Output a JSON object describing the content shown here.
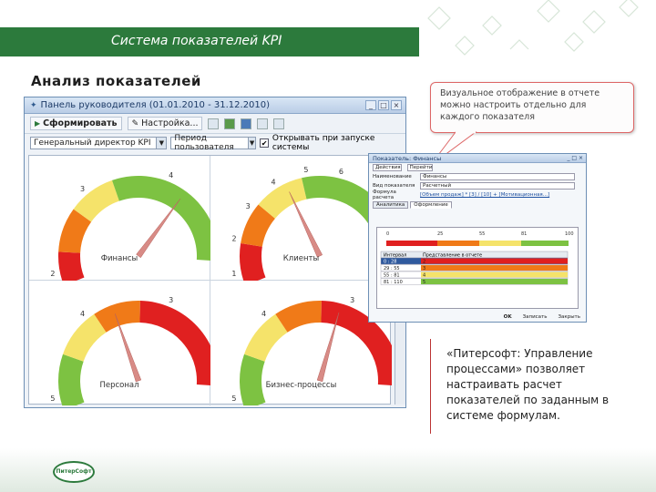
{
  "header": {
    "title": "Система показателей KPI"
  },
  "section_title": "Анализ показателей",
  "main_window": {
    "title": "Панель руководителя  (01.01.2010 - 31.12.2010)",
    "toolbar": {
      "generate_label": "Сформировать",
      "settings_label": "Настройка..."
    },
    "filters": {
      "indicator_value": "Генеральный директор KPI",
      "period_value": "Период пользователя",
      "open_on_start_label": "Открывать при запуске системы",
      "open_on_start_checked": true
    },
    "gauges": [
      {
        "label": "Финансы",
        "scale": [
          "2",
          "3",
          "4",
          "5"
        ],
        "level": 0.72
      },
      {
        "label": "Клиенты",
        "scale": [
          "1",
          "2",
          "3",
          "4",
          "5",
          "6",
          "7",
          "8",
          "9"
        ],
        "level": 0.42
      },
      {
        "label": "Персонал",
        "scale": [
          "5",
          "4",
          "3",
          "2"
        ],
        "level": 0.45
      },
      {
        "label": "Бизнес-процессы",
        "scale": [
          "5",
          "4",
          "3",
          "2"
        ],
        "level": 0.62
      }
    ]
  },
  "callout": {
    "text": "Визуальное отображение в отчете можно настроить отдельно для каждого показателя"
  },
  "small_window": {
    "title": "Показатель: Финансы",
    "menu": [
      "Действия",
      "Перейти"
    ],
    "fields": [
      {
        "label": "Наименование",
        "value": "Финансы"
      },
      {
        "label": "Вид показателя",
        "value": "Расчетный"
      },
      {
        "label": "Формула расчета",
        "value": "[Объем продаж] * [3] / [10] + [Мотивационная...]"
      }
    ],
    "tabs": [
      "Аналитика",
      "Оформление"
    ],
    "scale_ticks": [
      "0",
      "25",
      "55",
      "81",
      "100"
    ],
    "table_headers": [
      "Интервал",
      "Представление в отчете"
    ],
    "table_rows": [
      {
        "interval": "0 : 28",
        "repr": "2",
        "color": "#e02020"
      },
      {
        "interval": "29 : 55",
        "repr": "3",
        "color": "#f07a18"
      },
      {
        "interval": "55 : 81",
        "repr": "4",
        "color": "#f5e36a"
      },
      {
        "interval": "81 : 110",
        "repr": "5",
        "color": "#7dc242"
      }
    ],
    "buttons": [
      "OK",
      "Записать",
      "Закрыть"
    ]
  },
  "quote": "«Питерсофт: Управление процессами» позволяет настраивать расчет показателей по заданным в системе формулам.",
  "logo_text": "ПитерСофт",
  "colors": {
    "green": "#2c7a3c",
    "red": "#e02020",
    "orange": "#f07a18",
    "yellow": "#f5e36a",
    "lightgreen": "#7dc242"
  }
}
